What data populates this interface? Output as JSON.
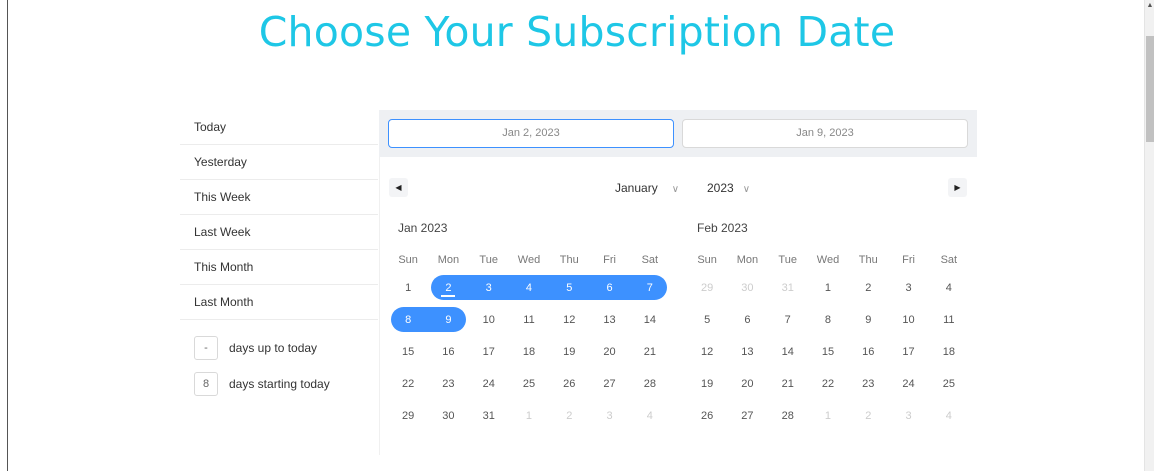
{
  "title": "Choose Your Subscription Date",
  "presets": [
    "Today",
    "Yesterday",
    "This Week",
    "Last Week",
    "This Month",
    "Last Month"
  ],
  "ranges": [
    {
      "value": "-",
      "label": "days up to today"
    },
    {
      "value": "8",
      "label": "days starting today"
    }
  ],
  "start_date": "Jan 2, 2023",
  "end_date": "Jan 9, 2023",
  "nav": {
    "prev": "◀",
    "next": "▶",
    "month": "January",
    "year": "2023",
    "chevron": "∨"
  },
  "weekdays": [
    "Sun",
    "Mon",
    "Tue",
    "Wed",
    "Thu",
    "Fri",
    "Sat"
  ],
  "colors": {
    "title": "#1ec7e6",
    "selection": "#3d91ff"
  },
  "calendars": [
    {
      "label": "Jan 2023",
      "weeks": [
        [
          {
            "d": "1"
          },
          {
            "d": "2",
            "s": 1,
            "first": 1
          },
          {
            "d": "3",
            "s": 1
          },
          {
            "d": "4",
            "s": 1
          },
          {
            "d": "5",
            "s": 1
          },
          {
            "d": "6",
            "s": 1
          },
          {
            "d": "7",
            "s": 1
          }
        ],
        [
          {
            "d": "8",
            "s": 1
          },
          {
            "d": "9",
            "s": 1
          },
          {
            "d": "10"
          },
          {
            "d": "11"
          },
          {
            "d": "12"
          },
          {
            "d": "13"
          },
          {
            "d": "14"
          }
        ],
        [
          {
            "d": "15"
          },
          {
            "d": "16"
          },
          {
            "d": "17"
          },
          {
            "d": "18"
          },
          {
            "d": "19"
          },
          {
            "d": "20"
          },
          {
            "d": "21"
          }
        ],
        [
          {
            "d": "22"
          },
          {
            "d": "23"
          },
          {
            "d": "24"
          },
          {
            "d": "25"
          },
          {
            "d": "26"
          },
          {
            "d": "27"
          },
          {
            "d": "28"
          }
        ],
        [
          {
            "d": "29"
          },
          {
            "d": "30"
          },
          {
            "d": "31"
          },
          {
            "d": "1",
            "p": 1
          },
          {
            "d": "2",
            "p": 1
          },
          {
            "d": "3",
            "p": 1
          },
          {
            "d": "4",
            "p": 1
          }
        ]
      ]
    },
    {
      "label": "Feb 2023",
      "weeks": [
        [
          {
            "d": "29",
            "p": 1
          },
          {
            "d": "30",
            "p": 1
          },
          {
            "d": "31",
            "p": 1
          },
          {
            "d": "1"
          },
          {
            "d": "2"
          },
          {
            "d": "3"
          },
          {
            "d": "4"
          }
        ],
        [
          {
            "d": "5"
          },
          {
            "d": "6"
          },
          {
            "d": "7"
          },
          {
            "d": "8"
          },
          {
            "d": "9"
          },
          {
            "d": "10"
          },
          {
            "d": "11"
          }
        ],
        [
          {
            "d": "12"
          },
          {
            "d": "13"
          },
          {
            "d": "14"
          },
          {
            "d": "15"
          },
          {
            "d": "16"
          },
          {
            "d": "17"
          },
          {
            "d": "18"
          }
        ],
        [
          {
            "d": "19"
          },
          {
            "d": "20"
          },
          {
            "d": "21"
          },
          {
            "d": "22"
          },
          {
            "d": "23"
          },
          {
            "d": "24"
          },
          {
            "d": "25"
          }
        ],
        [
          {
            "d": "26"
          },
          {
            "d": "27"
          },
          {
            "d": "28"
          },
          {
            "d": "1",
            "p": 1
          },
          {
            "d": "2",
            "p": 1
          },
          {
            "d": "3",
            "p": 1
          },
          {
            "d": "4",
            "p": 1
          }
        ]
      ]
    }
  ]
}
